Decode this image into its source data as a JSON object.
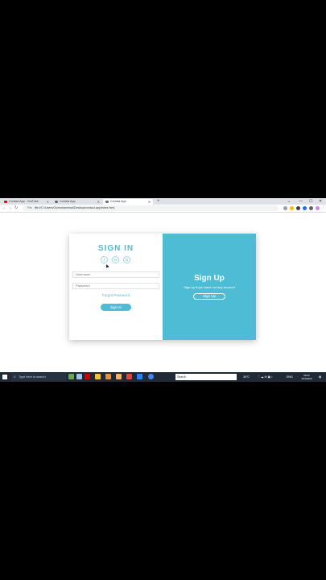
{
  "browser": {
    "tabs": [
      {
        "label": "Contact App - YouTube",
        "active": false,
        "favicon_color": "#ff0000"
      },
      {
        "label": "Contact App",
        "active": false,
        "favicon_color": "#5f6368"
      },
      {
        "label": "Contact App",
        "active": true,
        "favicon_color": "#5f6368"
      }
    ],
    "new_tab": "+",
    "address": {
      "scheme": "File",
      "url": "file:///C:/Users/Gulmuhammad/Desktop/contact-app/index.html"
    },
    "window_controls": [
      "⌄",
      "—",
      "☐",
      "✕"
    ]
  },
  "page": {
    "signin": {
      "title": "SIGN IN",
      "social": [
        "f",
        "G",
        "G"
      ],
      "username_placeholder": "Username",
      "password_placeholder": "Password",
      "forgot": "Forgot Password",
      "button": "Sign In"
    },
    "signup": {
      "title": "Sign Up",
      "subtitle": "Sign up if you have not any account",
      "button": "Sign Up"
    },
    "accent_color": "#4fbcd5"
  },
  "taskbar": {
    "search_placeholder": "Type here to search",
    "field_label": "Search",
    "weather": "34°C",
    "language": "ENG",
    "time": "09:01",
    "date": "2/11/2022"
  }
}
